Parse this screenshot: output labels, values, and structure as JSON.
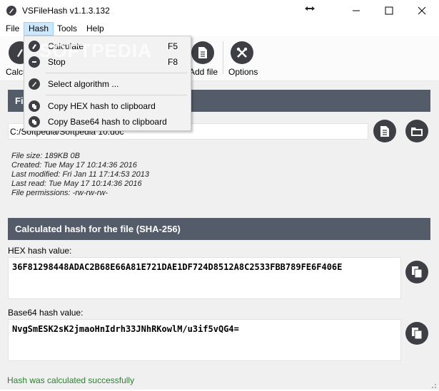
{
  "window": {
    "title": "VSFileHash v1.1.3.132"
  },
  "menubar": {
    "items": [
      "File",
      "Hash",
      "Tools",
      "Help"
    ]
  },
  "toolbar": {
    "calculate_label": "Calcu",
    "add_file_label": "Add file",
    "options_label": "Options"
  },
  "hash_menu": {
    "items": [
      {
        "label": "Calculate",
        "shortcut": "F5",
        "icon": "calculate-icon"
      },
      {
        "label": "Stop",
        "shortcut": "F8",
        "icon": "stop-icon"
      },
      {
        "label": "Select algorithm ...",
        "shortcut": "",
        "icon": "algorithm-icon"
      },
      {
        "label": "Copy HEX hash to clipboard",
        "shortcut": "",
        "icon": "copy-icon"
      },
      {
        "label": "Copy Base64 hash to clipboard",
        "shortcut": "",
        "icon": "copy-icon"
      }
    ]
  },
  "file_section": {
    "header": "Fil",
    "path": "C:/Softpedia/Softpedia 10.doc",
    "info": [
      "File size: 189KB 0B",
      "Created: Tue May 17 10:14:36 2016",
      "Last modified: Fri Jan 11 17:14:53 2013",
      "Last read: Tue May 17 10:14:36 2016",
      "File permissions: -rw-rw-rw-"
    ]
  },
  "hash_section": {
    "header": "Calculated hash for the file (SHA-256)",
    "hex_label": "HEX hash value:",
    "hex_value": "36F81298448ADAC2B68E66A81E721DAE1DF724D8512A8C2533FBB789FE6F406E",
    "base64_label": "Base64 hash value:",
    "base64_value": "NvgSmESK2sK2jmaoHnIdrh33JNhRKowlM/u3if5vQG4="
  },
  "status": {
    "text": "Hash was calculated successfully",
    "color": "#2e7d32"
  },
  "watermark": "SOFTPEDIA",
  "colors": {
    "header_bg": "#545c69",
    "button_bg": "#3d3f44",
    "menu_highlight": "#cce8ff"
  }
}
